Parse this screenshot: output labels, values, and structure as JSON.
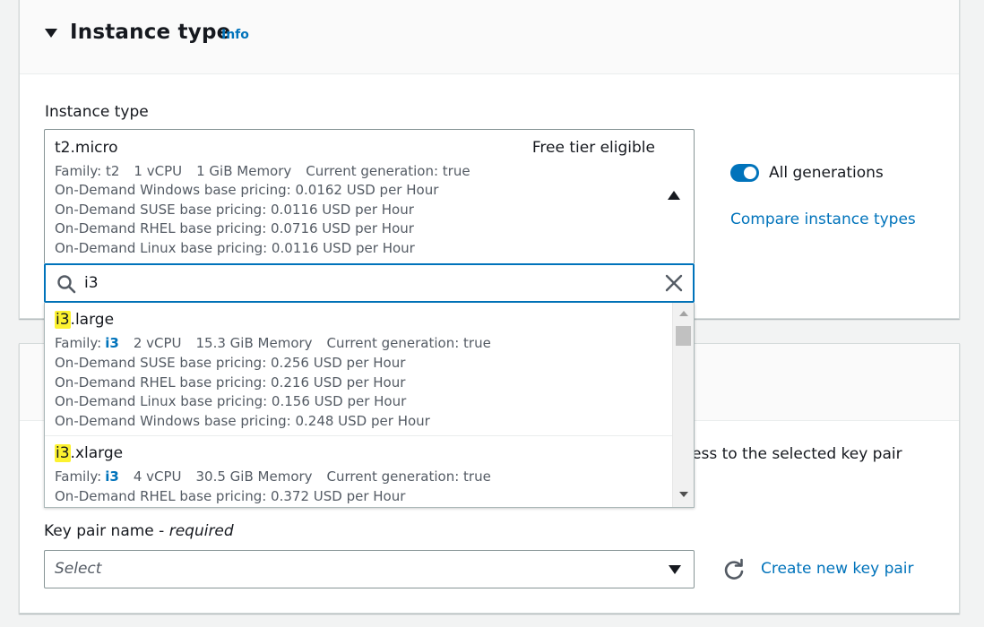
{
  "section": {
    "title": "Instance type",
    "info_link": "Info"
  },
  "instance_type_field": {
    "label": "Instance type",
    "selected": {
      "name": "t2.micro",
      "badge": "Free tier eligible",
      "family": "Family: t2",
      "vcpu": "1 vCPU",
      "memory": "1 GiB Memory",
      "generation": "Current generation: true",
      "pricing": [
        "On-Demand Windows base pricing: 0.0162 USD per Hour",
        "On-Demand SUSE base pricing: 0.0116 USD per Hour",
        "On-Demand RHEL base pricing: 0.0716 USD per Hour",
        "On-Demand Linux base pricing: 0.0116 USD per Hour"
      ]
    },
    "search": {
      "value": "i3"
    },
    "options": [
      {
        "name_match": "i3",
        "name_rest": ".large",
        "family_label": "Family:",
        "family_value": "i3",
        "vcpu": "2 vCPU",
        "memory": "15.3 GiB Memory",
        "generation": "Current generation: true",
        "pricing": [
          "On-Demand SUSE base pricing: 0.256 USD per Hour",
          "On-Demand RHEL base pricing: 0.216 USD per Hour",
          "On-Demand Linux base pricing: 0.156 USD per Hour",
          "On-Demand Windows base pricing: 0.248 USD per Hour"
        ]
      },
      {
        "name_match": "i3",
        "name_rest": ".xlarge",
        "family_label": "Family:",
        "family_value": "i3",
        "vcpu": "4 vCPU",
        "memory": "30.5 GiB Memory",
        "generation": "Current generation: true",
        "pricing": [
          "On-Demand RHEL base pricing: 0.372 USD per Hour"
        ]
      }
    ]
  },
  "side": {
    "toggle_label": "All generations",
    "compare_link": "Compare instance types"
  },
  "key_pair": {
    "partial_description": "ess to the selected key pair",
    "label": "Key pair name - ",
    "label_required": "required",
    "select_placeholder": "Select",
    "create_link": "Create new key pair"
  },
  "colors": {
    "accent": "#0073bb",
    "highlight": "#fcf230"
  }
}
